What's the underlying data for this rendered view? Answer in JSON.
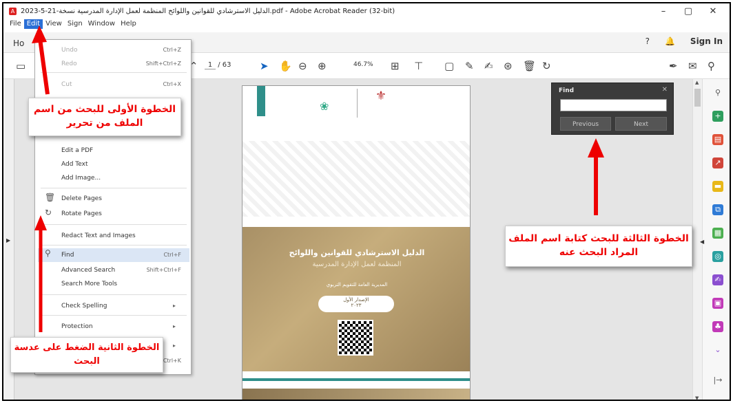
{
  "window": {
    "title": "2023-5-21-الدليل الاسترشادي للقوانين واللوائح المنظمة لعمل الإدارة المدرسية نسخة.pdf - Adobe Acrobat Reader (32-bit)",
    "controls": [
      "–",
      "▢",
      "✕"
    ]
  },
  "menubar": {
    "items": [
      "File",
      "Edit",
      "View",
      "Sign",
      "Window",
      "Help"
    ]
  },
  "tabs": {
    "home": "Ho",
    "sign_in": "Sign In"
  },
  "toolbar": {
    "page_current": "1",
    "page_total": "/ 63",
    "zoom": "46.7%"
  },
  "edit_menu": {
    "items": [
      {
        "label": "Undo",
        "shortcut": "Ctrl+Z",
        "disabled": true
      },
      {
        "label": "Redo",
        "shortcut": "Shift+Ctrl+Z",
        "disabled": true
      },
      {
        "label": "Cut",
        "shortcut": "Ctrl+X",
        "disabled": true
      },
      {
        "label": "Edit a PDF",
        "shortcut": ""
      },
      {
        "label": "Add Text",
        "shortcut": ""
      },
      {
        "label": "Add Image...",
        "shortcut": ""
      },
      {
        "label": "Delete Pages",
        "shortcut": ""
      },
      {
        "label": "Rotate Pages",
        "shortcut": ""
      },
      {
        "label": "Redact Text and Images",
        "shortcut": ""
      },
      {
        "label": "Find",
        "shortcut": "Ctrl+F"
      },
      {
        "label": "Advanced Search",
        "shortcut": "Shift+Ctrl+F"
      },
      {
        "label": "Search More Tools",
        "shortcut": ""
      },
      {
        "label": "Check Spelling",
        "shortcut": ""
      },
      {
        "label": "Protection",
        "shortcut": ""
      },
      {
        "label": "",
        "shortcut": "Ctrl+K"
      }
    ]
  },
  "find_panel": {
    "title": "Find",
    "previous": "Previous",
    "next": "Next",
    "value": ""
  },
  "document": {
    "cover_title": "الدليل الاسترشادي للقوانين واللوائح",
    "cover_subtitle": "المنظمة لعمل الإدارة المدرسية",
    "cover_small": "المديرية العامة للتقويم التربوي",
    "pill_line1": "الإصدار الأول",
    "pill_line2": "٢٠٢٣"
  },
  "annotations": {
    "step1": "الخطوة الأولى للبحث من اسم الملف من تحرير",
    "step2": "الخطوة الثانية الضغط على عدسة البحث",
    "step3": "الخطوة الثالثة للبحث كتابة اسم الملف المراد البحث عنه"
  },
  "colors": {
    "menu_highlight": "#2a6fd6",
    "annotation_red": "#e00000",
    "find_bg": "#3b3b3b"
  }
}
